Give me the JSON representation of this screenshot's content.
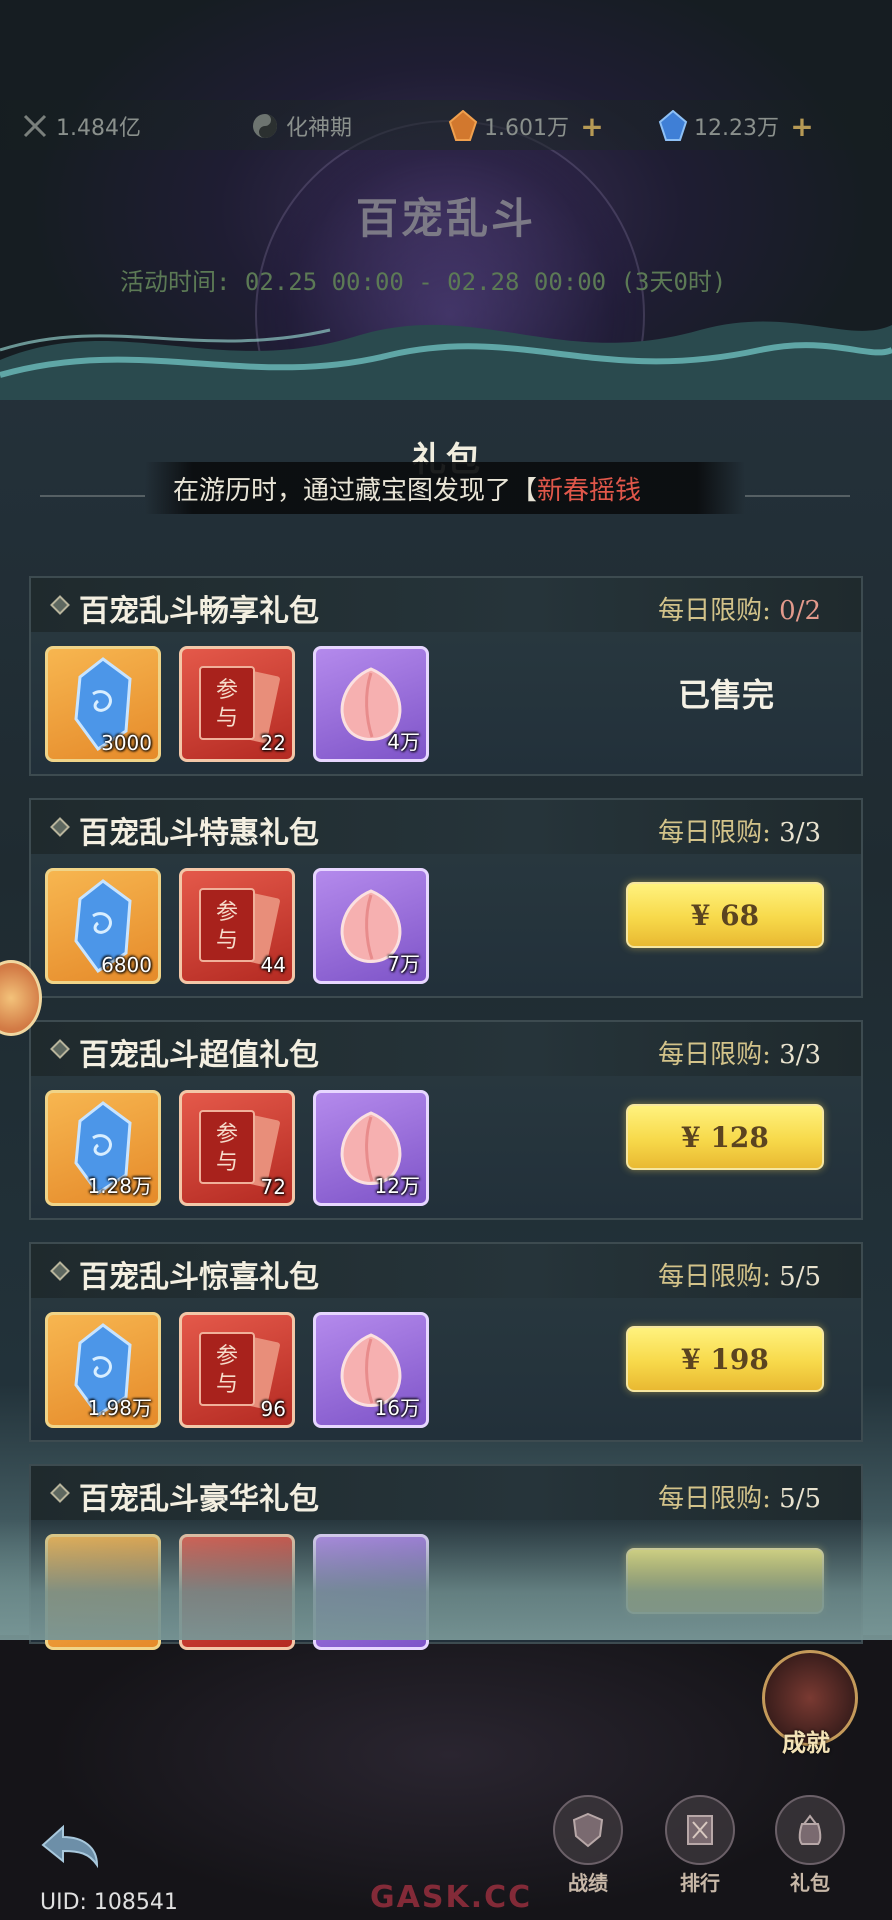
{
  "top_bar": {
    "power": "1.484亿",
    "realm": "化神期",
    "currency_orange": "1.601万",
    "currency_blue": "12.23万"
  },
  "event": {
    "title": "百宠乱斗",
    "time": "活动时间: 02.25 00:00 - 02.28 00:00 (3天0时)"
  },
  "section_title": "礼包",
  "toast": {
    "prefix": "在游历时，通过藏宝图发现了【",
    "highlight": "新春摇钱"
  },
  "packs": [
    {
      "name": "百宠乱斗畅享礼包",
      "limit_label": "每日限购:",
      "limit_count": "0/2",
      "items": [
        "3000",
        "22",
        "4万"
      ],
      "action": "已售完"
    },
    {
      "name": "百宠乱斗特惠礼包",
      "limit_label": "每日限购:",
      "limit_count": "3/3",
      "items": [
        "6800",
        "44",
        "7万"
      ],
      "action": "¥ 68"
    },
    {
      "name": "百宠乱斗超值礼包",
      "limit_label": "每日限购:",
      "limit_count": "3/3",
      "items": [
        "1.28万",
        "72",
        "12万"
      ],
      "action": "¥ 128"
    },
    {
      "name": "百宠乱斗惊喜礼包",
      "limit_label": "每日限购:",
      "limit_count": "5/5",
      "items": [
        "1.98万",
        "96",
        "16万"
      ],
      "action": "¥ 198"
    },
    {
      "name": "百宠乱斗豪华礼包",
      "limit_label": "每日限购:",
      "limit_count": "5/5"
    }
  ],
  "ticket_text": [
    "参",
    "与"
  ],
  "bottom_nav": {
    "achievement": "成就",
    "record": "战绩",
    "rank": "排行",
    "gift": "礼包"
  },
  "uid": "UID: 108541",
  "watermark": "GASK.CC",
  "colors": {
    "buy_button": "#f7d94a",
    "gem_bg": "#f7b650",
    "ticket_bg": "#e4594a",
    "peach_bg": "#b48aec",
    "toast_highlight": "#e0574a"
  }
}
